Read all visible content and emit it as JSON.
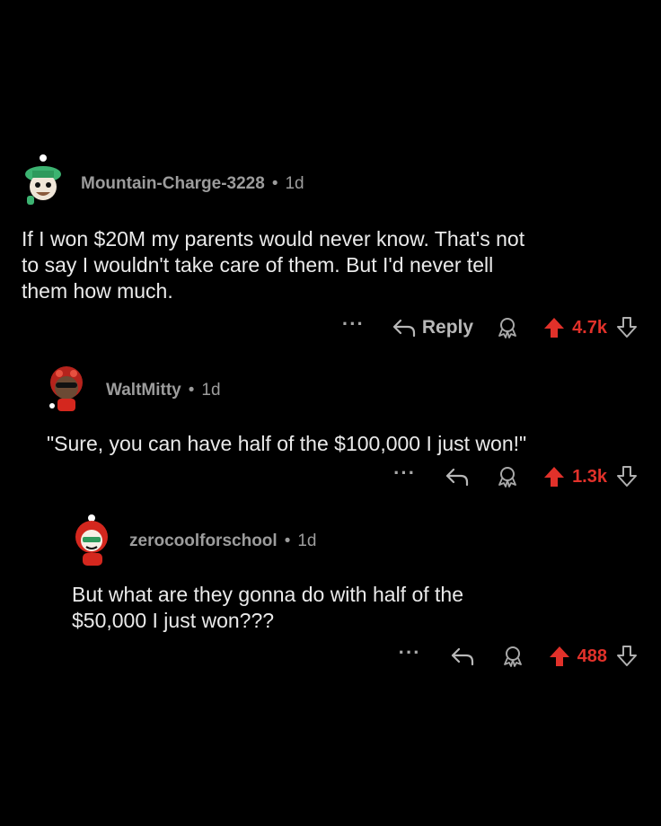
{
  "comments": [
    {
      "author": "Mountain-Charge-3228",
      "separator": "•",
      "age": "1d",
      "body": "If I won $20M my parents would never know. That's not\nto say I wouldn't take care of them. But I'd never tell\nthem how much.",
      "reply_label": "Reply",
      "score": "4.7k",
      "avatar_color": "#3cb371"
    },
    {
      "author": "WaltMitty",
      "separator": "•",
      "age": "1d",
      "body": "\"Sure, you can have half of the $100,000 I just won!\"",
      "score": "1.3k",
      "avatar_color": "#b5231c"
    },
    {
      "author": "zerocoolforschool",
      "separator": "•",
      "age": "1d",
      "body": "But what are they gonna do with half of the\n$50,000 I just won???",
      "score": "488",
      "avatar_color": "#d4271e"
    }
  ],
  "colors": {
    "background": "#000000",
    "upvote": "#e1312a",
    "meta": "#9c9c9c",
    "body": "#eaeaea"
  },
  "icons": [
    "more-icon",
    "reply-icon",
    "award-icon",
    "upvote-arrow-icon",
    "downvote-arrow-icon"
  ]
}
